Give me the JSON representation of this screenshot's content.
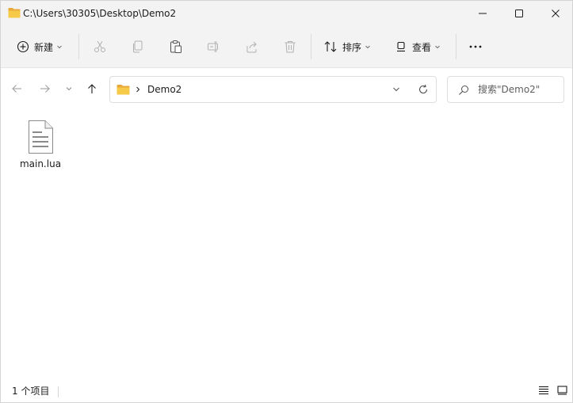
{
  "titlebar": {
    "title": "C:\\Users\\30305\\Desktop\\Demo2",
    "folder_icon": "folder-icon",
    "minimize_icon": "minimize-icon",
    "maximize_icon": "maximize-icon",
    "close_icon": "close-icon"
  },
  "toolbar": {
    "new_label": "新建",
    "sort_label": "排序",
    "view_label": "查看",
    "more_icon": "more-icon",
    "icons": [
      "cut-icon",
      "copy-icon",
      "paste-icon",
      "rename-icon",
      "share-icon",
      "delete-icon"
    ]
  },
  "navigation": {
    "back_icon": "arrow-left-icon",
    "forward_icon": "arrow-right-icon",
    "recent_icon": "chevron-down-icon",
    "up_icon": "arrow-up-icon"
  },
  "address": {
    "crumb": "Demo2"
  },
  "search": {
    "placeholder": "搜索\"Demo2\""
  },
  "files": [
    {
      "name": "main.lua",
      "icon": "text-file-icon"
    }
  ],
  "status": {
    "count_text": "1 个项目"
  },
  "colors": {
    "chrome_bg": "#f3f3f3",
    "folder_yellow": "#f7c948",
    "icon_gray": "#1b1b1b",
    "disabled_icon": "#b0b0b0"
  }
}
